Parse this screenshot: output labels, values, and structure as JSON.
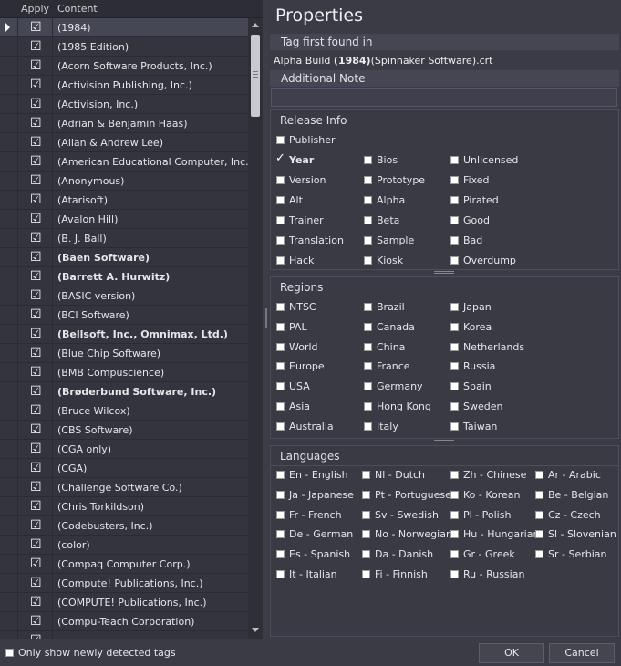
{
  "list": {
    "col_apply": "Apply",
    "col_content": "Content",
    "rows": [
      {
        "text": "(1984)",
        "bold": false,
        "selected": true
      },
      {
        "text": "(1985 Edition)",
        "bold": false
      },
      {
        "text": "(Acorn Software Products, Inc.)",
        "bold": false
      },
      {
        "text": "(Activision Publishing, Inc.)",
        "bold": false
      },
      {
        "text": "(Activision, Inc.)",
        "bold": false
      },
      {
        "text": "(Adrian & Benjamin Haas)",
        "bold": false
      },
      {
        "text": "(Allan & Andrew Lee)",
        "bold": false
      },
      {
        "text": "(American Educational Computer, Inc.)",
        "bold": false
      },
      {
        "text": "(Anonymous)",
        "bold": false
      },
      {
        "text": "(Atarisoft)",
        "bold": false
      },
      {
        "text": "(Avalon Hill)",
        "bold": false
      },
      {
        "text": "(B. J. Ball)",
        "bold": false
      },
      {
        "text": "(Baen Software)",
        "bold": true
      },
      {
        "text": "(Barrett A. Hurwitz)",
        "bold": true
      },
      {
        "text": "(BASIC version)",
        "bold": false
      },
      {
        "text": "(BCI Software)",
        "bold": false
      },
      {
        "text": "(Bellsoft, Inc., Omnimax, Ltd.)",
        "bold": true
      },
      {
        "text": "(Blue Chip Software)",
        "bold": false
      },
      {
        "text": "(BMB Compuscience)",
        "bold": false
      },
      {
        "text": "(Brøderbund Software, Inc.)",
        "bold": true
      },
      {
        "text": "(Bruce Wilcox)",
        "bold": false
      },
      {
        "text": "(CBS Software)",
        "bold": false
      },
      {
        "text": "(CGA only)",
        "bold": false
      },
      {
        "text": "(CGA)",
        "bold": false
      },
      {
        "text": "(Challenge Software Co.)",
        "bold": false
      },
      {
        "text": "(Chris Torkildson)",
        "bold": false
      },
      {
        "text": "(Codebusters, Inc.)",
        "bold": false
      },
      {
        "text": "(color)",
        "bold": false
      },
      {
        "text": "(Compaq Computer Corp.)",
        "bold": false
      },
      {
        "text": "(Compute! Publications, Inc.)",
        "bold": false
      },
      {
        "text": "(COMPUTE! Publications, Inc.)",
        "bold": false
      },
      {
        "text": "(Compu-Teach Corporation)",
        "bold": false
      },
      {
        "text": "",
        "bold": false
      }
    ]
  },
  "properties": {
    "title": "Properties",
    "tag_first_found_label": "Tag first found in",
    "tag_value_prefix": "Alpha Build ",
    "tag_value_bold": "(1984)",
    "tag_value_suffix": "(Spinnaker Software).crt",
    "additional_note_label": "Additional Note",
    "additional_note_value": "",
    "release_info": {
      "heading": "Release Info",
      "publisher": "Publisher",
      "items": [
        [
          "Year",
          "Bios",
          "Unlicensed"
        ],
        [
          "Version",
          "Prototype",
          "Fixed"
        ],
        [
          "Alt",
          "Alpha",
          "Pirated"
        ],
        [
          "Trainer",
          "Beta",
          "Good"
        ],
        [
          "Translation",
          "Sample",
          "Bad"
        ],
        [
          "Hack",
          "Kiosk",
          "Overdump"
        ]
      ],
      "checked": [
        "Year"
      ]
    },
    "regions": {
      "heading": "Regions",
      "items": [
        [
          "NTSC",
          "Brazil",
          "Japan"
        ],
        [
          "PAL",
          "Canada",
          "Korea"
        ],
        [
          "World",
          "China",
          "Netherlands"
        ],
        [
          "Europe",
          "France",
          "Russia"
        ],
        [
          "USA",
          "Germany",
          "Spain"
        ],
        [
          "Asia",
          "Hong Kong",
          "Sweden"
        ],
        [
          "Australia",
          "Italy",
          "Taiwan"
        ]
      ]
    },
    "languages": {
      "heading": "Languages",
      "items": [
        [
          "En - English",
          "Nl - Dutch",
          "Zh - Chinese",
          "Ar - Arabic"
        ],
        [
          "Ja - Japanese",
          "Pt - Portuguese",
          "Ko - Korean",
          "Be - Belgian"
        ],
        [
          "Fr - French",
          "Sv - Swedish",
          "Pl - Polish",
          "Cz - Czech"
        ],
        [
          "De - German",
          "No - Norwegian",
          "Hu - Hungarian",
          "Sl - Slovenian"
        ],
        [
          "Es - Spanish",
          "Da - Danish",
          "Gr - Greek",
          "Sr - Serbian"
        ],
        [
          "It - Italian",
          "Fi - Finnish",
          "Ru - Russian",
          ""
        ]
      ]
    }
  },
  "footer": {
    "only_new_label": "Only show newly detected tags",
    "ok_label": "OK",
    "cancel_label": "Cancel"
  }
}
